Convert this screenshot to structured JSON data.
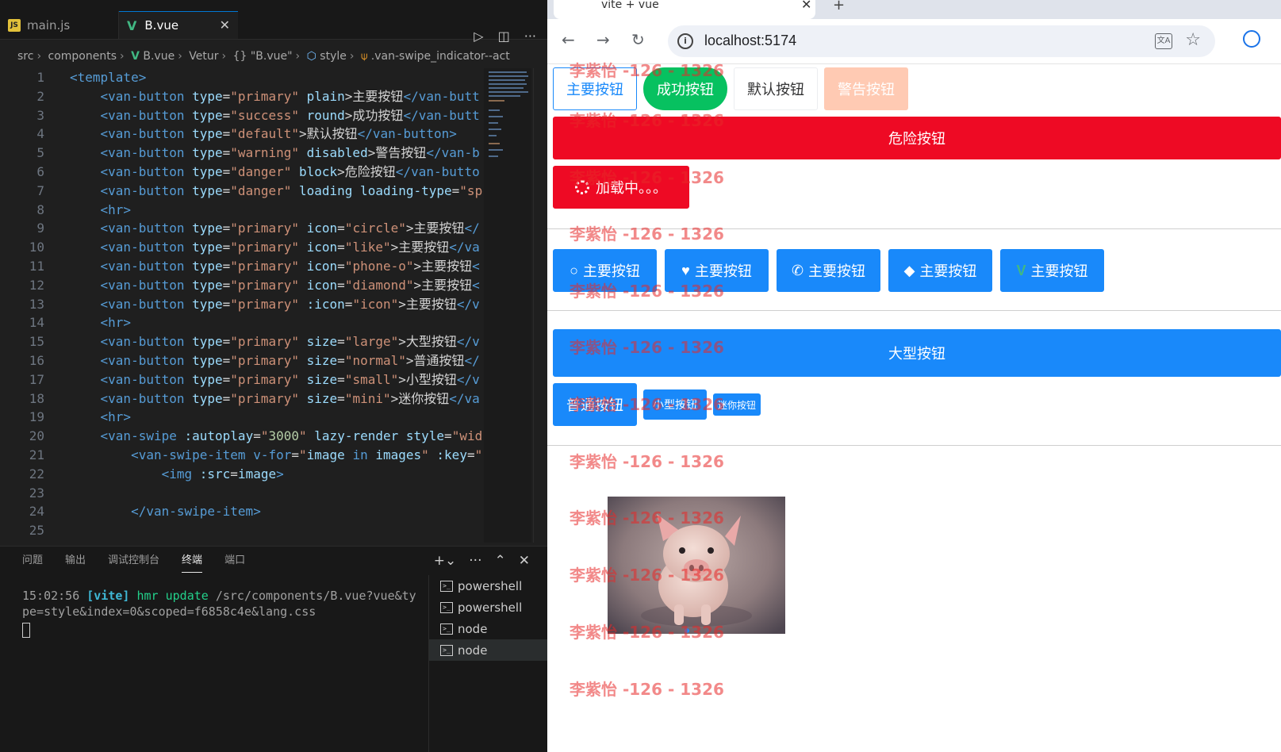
{
  "editor": {
    "tabs": [
      {
        "label": "main.js",
        "icon": "js-file-icon"
      },
      {
        "label": "B.vue",
        "icon": "vue-file-icon"
      }
    ],
    "breadcrumbs": [
      "src",
      "components",
      "B.vue",
      "Vetur",
      "{} \"B.vue\"",
      "style",
      ".van-swipe_indicator--act"
    ],
    "code_lines": [
      {
        "n": "1",
        "ind": 0,
        "t": [
          [
            "tag",
            "<template>"
          ]
        ]
      },
      {
        "n": "2",
        "ind": 1,
        "t": [
          [
            "tag",
            "<van-button "
          ],
          [
            "attr",
            "type"
          ],
          [
            "txt",
            "="
          ],
          [
            "str",
            "\"primary\""
          ],
          [
            "attr",
            " plain"
          ],
          [
            "txt",
            ">主要按钮"
          ],
          [
            "tag",
            "</van-butt"
          ]
        ]
      },
      {
        "n": "3",
        "ind": 1,
        "t": [
          [
            "tag",
            "<van-button "
          ],
          [
            "attr",
            "type"
          ],
          [
            "txt",
            "="
          ],
          [
            "str",
            "\"success\""
          ],
          [
            "attr",
            " round"
          ],
          [
            "txt",
            ">成功按钮"
          ],
          [
            "tag",
            "</van-butt"
          ]
        ]
      },
      {
        "n": "4",
        "ind": 1,
        "t": [
          [
            "tag",
            "<van-button "
          ],
          [
            "attr",
            "type"
          ],
          [
            "txt",
            "="
          ],
          [
            "str",
            "\"default\""
          ],
          [
            "txt",
            ">默认按钮"
          ],
          [
            "tag",
            "</van-button>"
          ]
        ]
      },
      {
        "n": "5",
        "ind": 1,
        "t": [
          [
            "tag",
            "<van-button "
          ],
          [
            "attr",
            "type"
          ],
          [
            "txt",
            "="
          ],
          [
            "str",
            "\"warning\""
          ],
          [
            "attr",
            " disabled"
          ],
          [
            "txt",
            ">警告按钮"
          ],
          [
            "tag",
            "</van-b"
          ]
        ]
      },
      {
        "n": "6",
        "ind": 1,
        "t": [
          [
            "tag",
            "<van-button "
          ],
          [
            "attr",
            "type"
          ],
          [
            "txt",
            "="
          ],
          [
            "str",
            "\"danger\""
          ],
          [
            "attr",
            " block"
          ],
          [
            "txt",
            ">危险按钮"
          ],
          [
            "tag",
            "</van-butto"
          ]
        ]
      },
      {
        "n": "7",
        "ind": 1,
        "t": [
          [
            "tag",
            "<van-button "
          ],
          [
            "attr",
            "type"
          ],
          [
            "txt",
            "="
          ],
          [
            "str",
            "\"danger\""
          ],
          [
            "attr",
            " loading loading-type"
          ],
          [
            "txt",
            "="
          ],
          [
            "str",
            "\"sp"
          ]
        ]
      },
      {
        "n": "8",
        "ind": 1,
        "t": [
          [
            "tag",
            "<hr>"
          ]
        ]
      },
      {
        "n": "9",
        "ind": 1,
        "t": [
          [
            "tag",
            "<van-button "
          ],
          [
            "attr",
            "type"
          ],
          [
            "txt",
            "="
          ],
          [
            "str",
            "\"primary\""
          ],
          [
            "attr",
            " icon"
          ],
          [
            "txt",
            "="
          ],
          [
            "str",
            "\"circle\""
          ],
          [
            "txt",
            ">主要按钮"
          ],
          [
            "tag",
            "</"
          ]
        ]
      },
      {
        "n": "10",
        "ind": 1,
        "t": [
          [
            "tag",
            "<van-button "
          ],
          [
            "attr",
            "type"
          ],
          [
            "txt",
            "="
          ],
          [
            "str",
            "\"primary\""
          ],
          [
            "attr",
            " icon"
          ],
          [
            "txt",
            "="
          ],
          [
            "str",
            "\"like\""
          ],
          [
            "txt",
            ">主要按钮"
          ],
          [
            "tag",
            "</va"
          ]
        ]
      },
      {
        "n": "11",
        "ind": 1,
        "t": [
          [
            "tag",
            "<van-button "
          ],
          [
            "attr",
            "type"
          ],
          [
            "txt",
            "="
          ],
          [
            "str",
            "\"primary\""
          ],
          [
            "attr",
            " icon"
          ],
          [
            "txt",
            "="
          ],
          [
            "str",
            "\"phone-o\""
          ],
          [
            "txt",
            ">主要按钮"
          ],
          [
            "tag",
            "<"
          ]
        ]
      },
      {
        "n": "12",
        "ind": 1,
        "t": [
          [
            "tag",
            "<van-button "
          ],
          [
            "attr",
            "type"
          ],
          [
            "txt",
            "="
          ],
          [
            "str",
            "\"primary\""
          ],
          [
            "attr",
            " icon"
          ],
          [
            "txt",
            "="
          ],
          [
            "str",
            "\"diamond\""
          ],
          [
            "txt",
            ">主要按钮"
          ],
          [
            "tag",
            "<"
          ]
        ]
      },
      {
        "n": "13",
        "ind": 1,
        "t": [
          [
            "tag",
            "<van-button "
          ],
          [
            "attr",
            "type"
          ],
          [
            "txt",
            "="
          ],
          [
            "str",
            "\"primary\""
          ],
          [
            "attr",
            " :icon"
          ],
          [
            "txt",
            "="
          ],
          [
            "str",
            "\"icon\""
          ],
          [
            "txt",
            ">主要按钮"
          ],
          [
            "tag",
            "</v"
          ]
        ]
      },
      {
        "n": "14",
        "ind": 1,
        "t": [
          [
            "tag",
            "<hr>"
          ]
        ]
      },
      {
        "n": "15",
        "ind": 1,
        "t": [
          [
            "tag",
            "<van-button "
          ],
          [
            "attr",
            "type"
          ],
          [
            "txt",
            "="
          ],
          [
            "str",
            "\"primary\""
          ],
          [
            "attr",
            " size"
          ],
          [
            "txt",
            "="
          ],
          [
            "str",
            "\"large\""
          ],
          [
            "txt",
            ">大型按钮"
          ],
          [
            "tag",
            "</v"
          ]
        ]
      },
      {
        "n": "16",
        "ind": 1,
        "t": [
          [
            "tag",
            "<van-button "
          ],
          [
            "attr",
            "type"
          ],
          [
            "txt",
            "="
          ],
          [
            "str",
            "\"primary\""
          ],
          [
            "attr",
            " size"
          ],
          [
            "txt",
            "="
          ],
          [
            "str",
            "\"normal\""
          ],
          [
            "txt",
            ">普通按钮"
          ],
          [
            "tag",
            "</"
          ]
        ]
      },
      {
        "n": "17",
        "ind": 1,
        "t": [
          [
            "tag",
            "<van-button "
          ],
          [
            "attr",
            "type"
          ],
          [
            "txt",
            "="
          ],
          [
            "str",
            "\"primary\""
          ],
          [
            "attr",
            " size"
          ],
          [
            "txt",
            "="
          ],
          [
            "str",
            "\"small\""
          ],
          [
            "txt",
            ">小型按钮"
          ],
          [
            "tag",
            "</v"
          ]
        ]
      },
      {
        "n": "18",
        "ind": 1,
        "t": [
          [
            "tag",
            "<van-button "
          ],
          [
            "attr",
            "type"
          ],
          [
            "txt",
            "="
          ],
          [
            "str",
            "\"primary\""
          ],
          [
            "attr",
            " size"
          ],
          [
            "txt",
            "="
          ],
          [
            "str",
            "\"mini\""
          ],
          [
            "txt",
            ">迷你按钮"
          ],
          [
            "tag",
            "</va"
          ]
        ]
      },
      {
        "n": "19",
        "ind": 1,
        "t": [
          [
            "tag",
            "<hr>"
          ]
        ]
      },
      {
        "n": "20",
        "ind": 1,
        "t": [
          [
            "tag",
            "<van-swipe "
          ],
          [
            "attr",
            ":autoplay"
          ],
          [
            "txt",
            "="
          ],
          [
            "str",
            "\""
          ],
          [
            "num",
            "3000"
          ],
          [
            "str",
            "\""
          ],
          [
            "attr",
            " lazy-render style"
          ],
          [
            "txt",
            "="
          ],
          [
            "str",
            "\"wid"
          ]
        ]
      },
      {
        "n": "21",
        "ind": 2,
        "t": [
          [
            "tag",
            "<van-swipe-item "
          ],
          [
            "kw",
            "v-for"
          ],
          [
            "txt",
            "="
          ],
          [
            "str",
            "\""
          ],
          [
            "attr",
            "image "
          ],
          [
            "kw",
            "in"
          ],
          [
            "attr",
            " images"
          ],
          [
            "str",
            "\""
          ],
          [
            "attr",
            " :key"
          ],
          [
            "txt",
            "="
          ],
          [
            "str",
            "\""
          ]
        ]
      },
      {
        "n": "22",
        "ind": 3,
        "t": [
          [
            "tag",
            "<img "
          ],
          [
            "attr",
            ":src"
          ],
          [
            "txt",
            "="
          ],
          [
            "attr",
            "image"
          ],
          [
            "tag",
            ">"
          ]
        ]
      },
      {
        "n": "23",
        "ind": 0,
        "t": []
      },
      {
        "n": "24",
        "ind": 2,
        "t": [
          [
            "tag",
            "</van-swipe-item>"
          ]
        ]
      },
      {
        "n": "25",
        "ind": 0,
        "t": []
      }
    ],
    "panel_tabs": [
      "问题",
      "输出",
      "调试控制台",
      "终端",
      "端口"
    ],
    "active_panel_tab": "终端",
    "terminal": {
      "time": "15:02:56",
      "tag": "[vite]",
      "msg": "hmr update",
      "path": "/src/components/B.vue?vue&type=style&index=0&scoped=f6858c4e&lang.css"
    },
    "terminals": [
      "powershell",
      "powershell",
      "node",
      "node"
    ]
  },
  "browser": {
    "tab_title": "vite + vue",
    "url": "localhost:5174",
    "buttons": {
      "primary_plain": "主要按钮",
      "success_round": "成功按钮",
      "default": "默认按钮",
      "warning_disabled": "警告按钮",
      "danger_block": "危险按钮",
      "loading": "加载中。。。"
    },
    "icon_buttons": [
      {
        "label": "主要按钮",
        "icon": "circle-icon"
      },
      {
        "label": "主要按钮",
        "icon": "like-icon"
      },
      {
        "label": "主要按钮",
        "icon": "phone-icon"
      },
      {
        "label": "主要按钮",
        "icon": "diamond-icon"
      },
      {
        "label": "主要按钮",
        "icon": "vue-logo-icon"
      }
    ],
    "size_buttons": {
      "large": "大型按钮",
      "normal": "普通按钮",
      "small": "小型按钮",
      "mini": "迷你按钮"
    },
    "watermark": "李紫怡 -126 - 1326",
    "colors": {
      "primary": "#1989fa",
      "success": "#07c160",
      "warning": "#ff976a",
      "danger": "#ee0a24"
    }
  }
}
